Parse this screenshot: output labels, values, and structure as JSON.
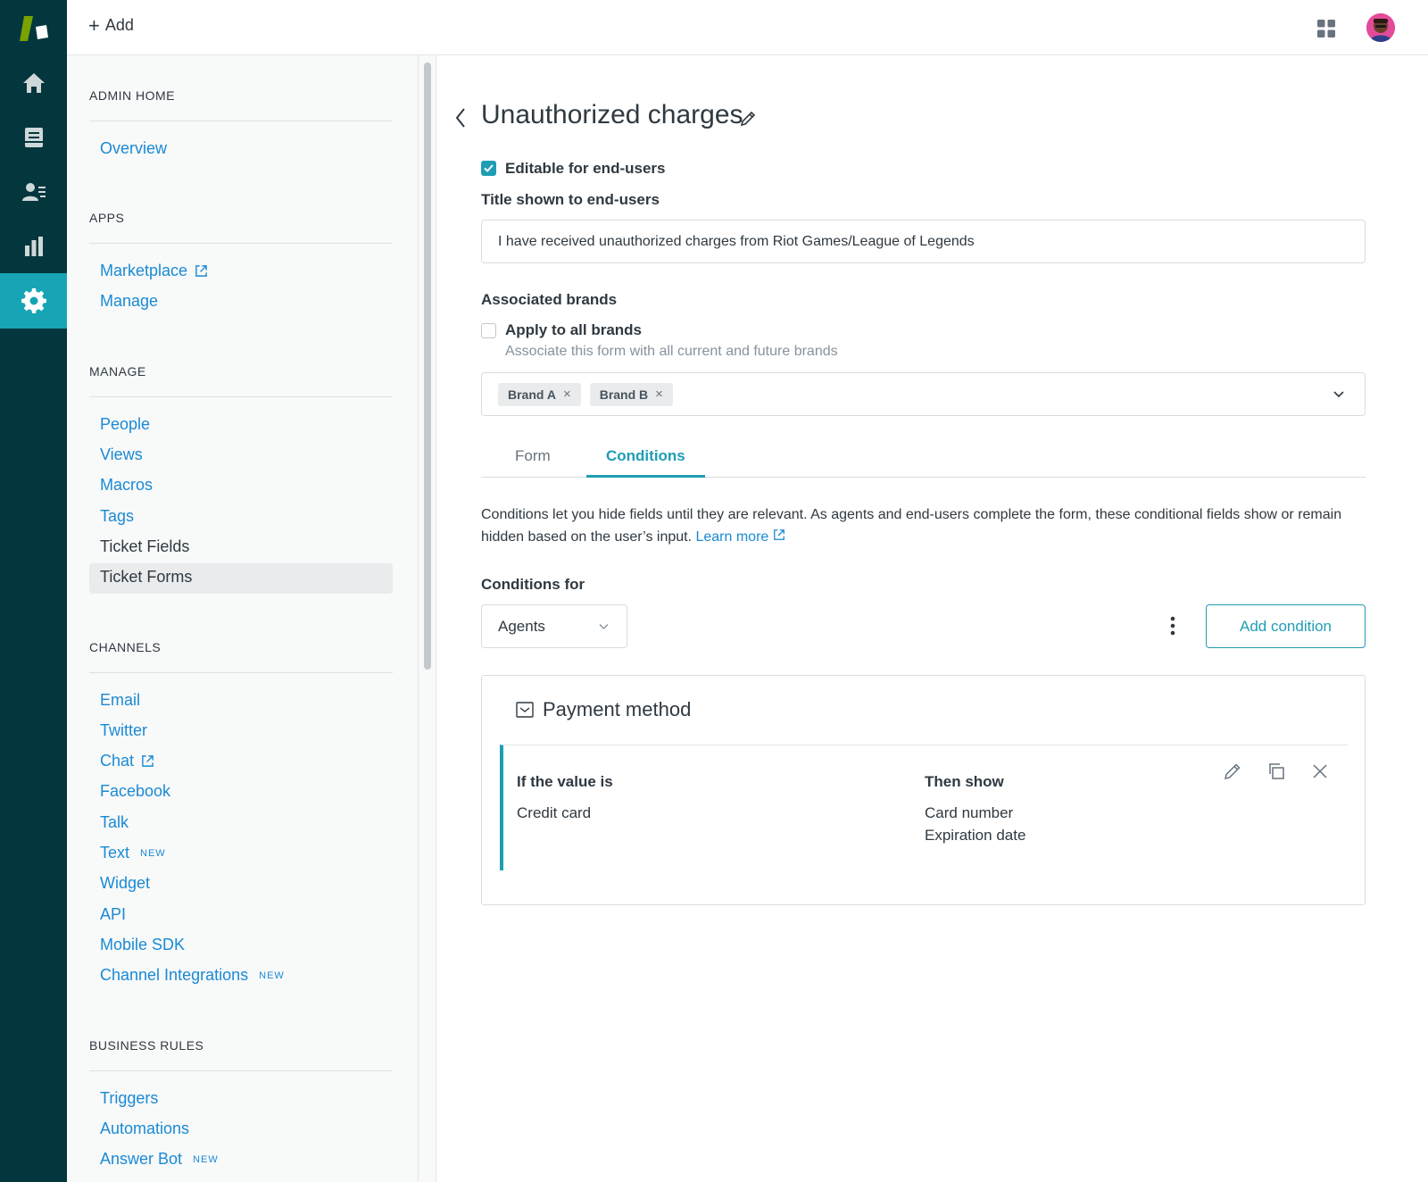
{
  "topbar": {
    "add_label": "Add"
  },
  "rail": {
    "items": [
      {
        "icon": "home-icon"
      },
      {
        "icon": "views-icon"
      },
      {
        "icon": "customers-icon"
      },
      {
        "icon": "reporting-icon"
      },
      {
        "icon": "gear-icon"
      }
    ]
  },
  "sidebar": {
    "admin_home": {
      "heading": "Admin Home",
      "items": [
        "Overview"
      ]
    },
    "apps": {
      "heading": "Apps",
      "items": [
        "Marketplace",
        "Manage"
      ]
    },
    "manage": {
      "heading": "Manage",
      "items": [
        "People",
        "Views",
        "Macros",
        "Tags",
        "Ticket Fields",
        "Ticket Forms"
      ]
    },
    "channels": {
      "heading": "Channels",
      "items": [
        "Email",
        "Twitter",
        "Chat",
        "Facebook",
        "Talk",
        "Text",
        "Widget",
        "API",
        "Mobile SDK",
        "Channel Integrations"
      ],
      "new_badge": "NEW"
    },
    "business_rules": {
      "heading": "Business Rules",
      "items": [
        "Triggers",
        "Automations",
        "Answer Bot"
      ]
    }
  },
  "main": {
    "title": "Unauthorized charges",
    "editable_label": "Editable for end-users",
    "title_field_label": "Title shown to end-users",
    "title_field_value": "I have received unauthorized charges from Riot Games/League of Legends",
    "brands_label": "Associated brands",
    "apply_all_label": "Apply to all brands",
    "apply_all_hint": "Associate this form with all current and future brands",
    "brands": [
      "Brand A",
      "Brand B"
    ],
    "tabs": [
      {
        "label": "Form",
        "active": false
      },
      {
        "label": "Conditions",
        "active": true
      }
    ],
    "conditions_desc": "Conditions let you hide fields until they are relevant. As agents and end-users complete the form, these conditional fields show or remain hidden based on the user’s input.",
    "learn_more": "Learn more",
    "conditions_for_label": "Conditions for",
    "conditions_for_value": "Agents",
    "add_condition": "Add condition",
    "condition": {
      "field": "Payment method",
      "if_head": "If the value is",
      "if_value": "Credit card",
      "then_head": "Then show",
      "then_values": [
        "Card number",
        "Expiration date"
      ]
    }
  },
  "colors": {
    "rail": "#03363d",
    "accent": "#1f9db4",
    "link": "#1a8ad4"
  }
}
